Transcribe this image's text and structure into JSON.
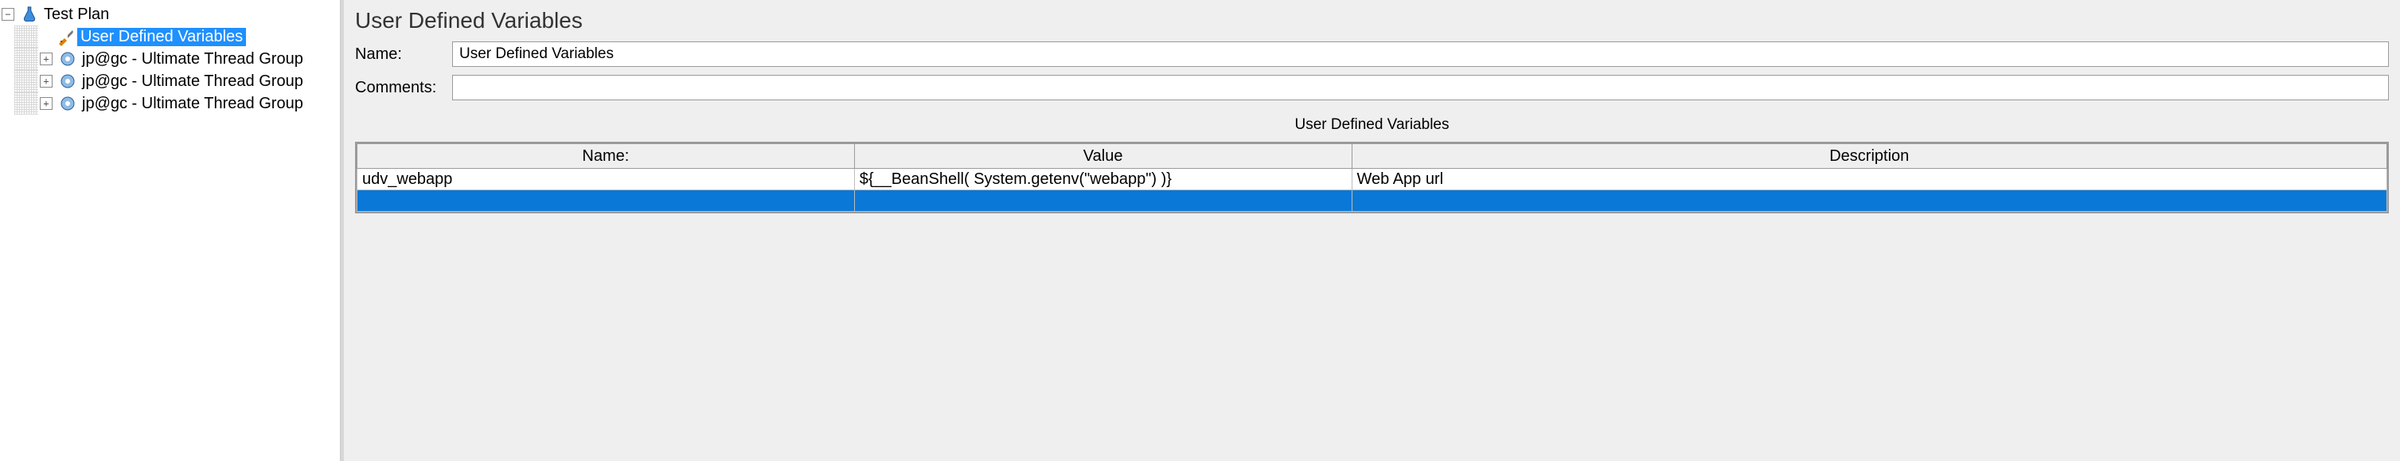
{
  "tree": {
    "root_label": "Test Plan",
    "children": [
      {
        "label": "User Defined Variables",
        "icon": "wrench-screwdriver",
        "selected": true,
        "expandable": false
      },
      {
        "label": "jp@gc - Ultimate Thread Group",
        "icon": "gear",
        "selected": false,
        "expandable": true
      },
      {
        "label": "jp@gc - Ultimate Thread Group",
        "icon": "gear",
        "selected": false,
        "expandable": true
      },
      {
        "label": "jp@gc - Ultimate Thread Group",
        "icon": "gear",
        "selected": false,
        "expandable": true
      }
    ]
  },
  "panel": {
    "title": "User Defined Variables",
    "name_label": "Name:",
    "name_value": "User Defined Variables",
    "comments_label": "Comments:",
    "comments_value": "",
    "table_section_title": "User Defined Variables",
    "table_headers": {
      "name": "Name:",
      "value": "Value",
      "description": "Description"
    },
    "table_rows": [
      {
        "name": "udv_webapp",
        "value": "${__BeanShell( System.getenv(\"webapp\") )}",
        "description": "Web App url"
      }
    ]
  },
  "glyphs": {
    "minus": "−",
    "plus": "+"
  }
}
